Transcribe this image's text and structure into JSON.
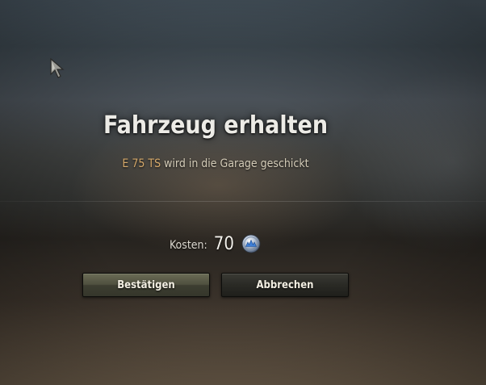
{
  "dialog": {
    "title": "Fahrzeug erhalten",
    "vehicle_name": "E 75 TS",
    "message": "wird in die Garage geschickt",
    "cost_label": "Kosten:",
    "cost_value": "70",
    "currency_icon": "gold-coin-icon"
  },
  "buttons": {
    "confirm_label": "Bestätigen",
    "cancel_label": "Abbrechen"
  },
  "colors": {
    "vehicle_name": "#d6a96a",
    "title": "#ecebe6",
    "message": "#d4ccb8"
  }
}
